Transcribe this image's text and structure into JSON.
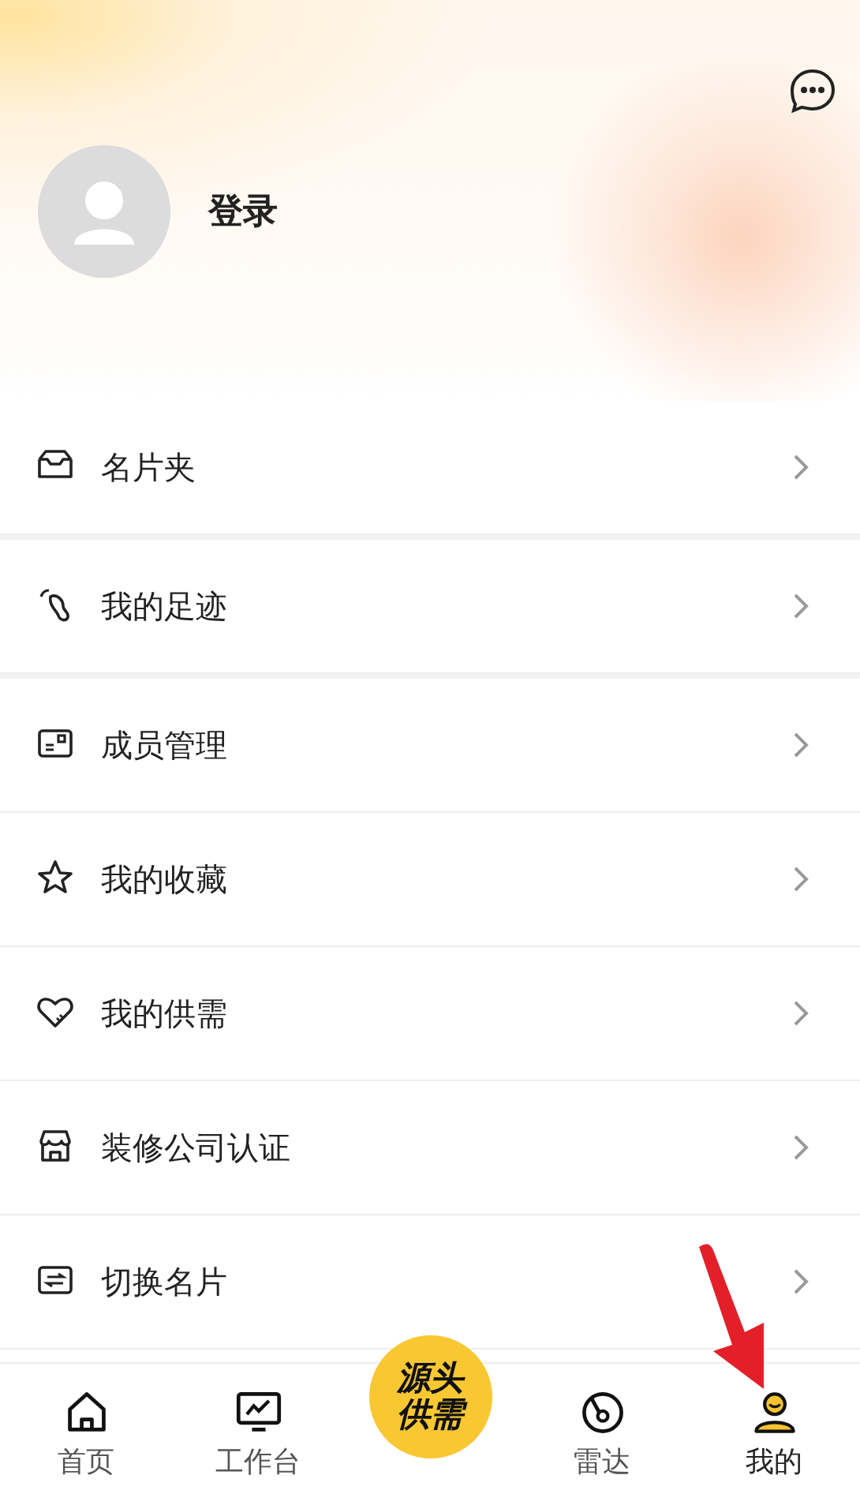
{
  "header": {
    "login_label": "登录"
  },
  "sections": [
    {
      "items": [
        {
          "kind": "folder",
          "label": "名片夹"
        }
      ]
    },
    {
      "items": [
        {
          "kind": "footprint",
          "label": "我的足迹"
        }
      ]
    },
    {
      "items": [
        {
          "kind": "idcard",
          "label": "成员管理"
        },
        {
          "kind": "star",
          "label": "我的收藏"
        },
        {
          "kind": "heart",
          "label": "我的供需"
        },
        {
          "kind": "shop",
          "label": "装修公司认证"
        },
        {
          "kind": "switch",
          "label": "切换名片"
        }
      ]
    }
  ],
  "tab_bar": {
    "tabs": [
      {
        "kind": "home",
        "label": "首页",
        "selected": false
      },
      {
        "kind": "monitor",
        "label": "工作台",
        "selected": false
      },
      {
        "kind": "center",
        "label": "源头供需",
        "selected": false
      },
      {
        "kind": "radar",
        "label": "雷达",
        "selected": false
      },
      {
        "kind": "person",
        "label": "我的",
        "selected": true
      }
    ]
  }
}
